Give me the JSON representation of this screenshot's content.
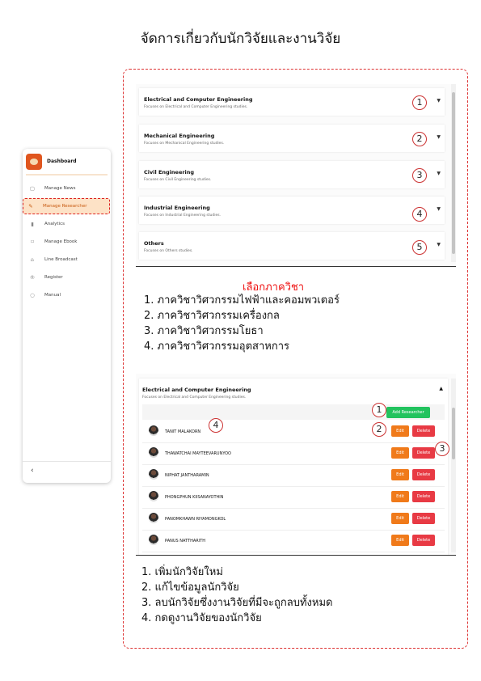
{
  "page_title": "จัดการเกี่ยวกับนักวิจัยและงานวิจัย",
  "sidebar": {
    "title": "Dashboard",
    "items": [
      {
        "label": "Manage News",
        "icon": "news-icon"
      },
      {
        "label": "Manage Researcher",
        "icon": "edit-icon",
        "active": true
      },
      {
        "label": "Analytics",
        "icon": "bar-chart-icon"
      },
      {
        "label": "Manage Ebook",
        "icon": "bookmark-icon"
      },
      {
        "label": "Line Broadcast",
        "icon": "home-icon"
      },
      {
        "label": "Register",
        "icon": "register-icon"
      },
      {
        "label": "Manual",
        "icon": "circle-icon"
      }
    ],
    "collapse_glyph": "‹"
  },
  "departments": [
    {
      "title": "Electrical and Computer Engineering",
      "subtitle": "Focuses on Electrical and Computer Engineering studies.",
      "marker": "1"
    },
    {
      "title": "Mechanical Engineering",
      "subtitle": "Focuses on Mechanical Engineering studies.",
      "marker": "2"
    },
    {
      "title": "Civil Engineering",
      "subtitle": "Focuses on Civil Engineering studies.",
      "marker": "3"
    },
    {
      "title": "Industrial Engineering",
      "subtitle": "Focuses on Industrial Engineering studies.",
      "marker": "4"
    },
    {
      "title": "Others",
      "subtitle": "Focuses on Others studies.",
      "marker": "5"
    }
  ],
  "select_title": "เลือกภาควิชา",
  "select_list": [
    "1. ภาควิชาวิศวกรรมไฟฟ้าและคอมพวเตอร์",
    "2. ภาควิชาวิศวกรรมเครื่องกล",
    "3. ภาควิชาวิศวกรรมโยธา",
    "4. ภาควิชาวิศวกรรมอุตสาหการ"
  ],
  "researcher_panel": {
    "title": "Electrical and Computer Engineering",
    "subtitle": "Focuses on Electrical and Computer Engineering studies.",
    "add_label": "Add Researcher",
    "edit_label": "Edit",
    "delete_label": "Delete",
    "researchers": [
      "TANIT MALAKORN",
      "THAWATCHAI MAYTEEVARUNYOO",
      "NIPHAT JANTHARAMIN",
      "PHONGPHUN KIISANAYOTHIN",
      "PANOMKHAWN RIYAMONGKOL",
      "PANUS NATTHARITH"
    ],
    "markers": [
      "1",
      "2",
      "3",
      "4"
    ]
  },
  "actions_list": [
    "1. เพิ่มนักวิจัยใหม่",
    "2. แก้ไขข้อมูลนักวิจัย",
    "3. ลบนักวิจัยซึ่งงานวิจัยที่มีจะถูกลบทั้งหมด",
    "4. กดดูงานวิจัยของนักวิจัย"
  ],
  "colors": {
    "accent": "#e0561f",
    "annotation_red": "#dd3333",
    "add_green": "#22c35e",
    "edit_orange": "#f07a1a",
    "delete_red": "#e83a44"
  }
}
